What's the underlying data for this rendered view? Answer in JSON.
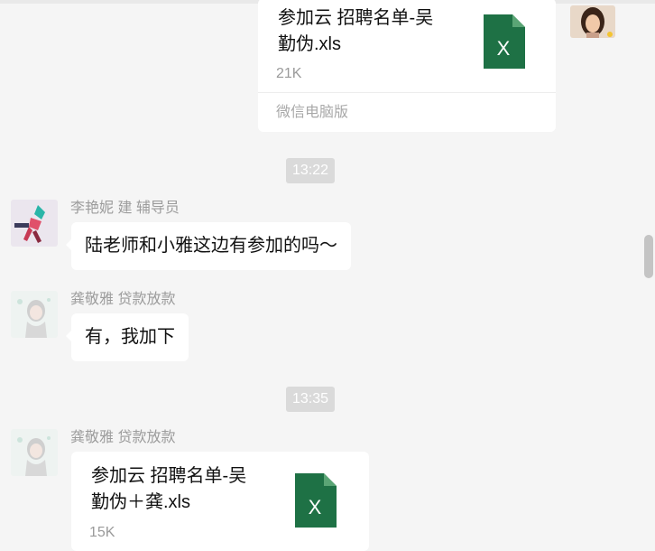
{
  "messages": {
    "file1": {
      "name_line1": "参加云 招聘名单-吴",
      "name_line2": "勤伪.xls",
      "size": "21K",
      "source": "微信电脑版",
      "icon": "excel-file-icon",
      "icon_letter": "X"
    },
    "time1": "13:22",
    "msg1": {
      "sender": "李艳妮 建 辅导员",
      "text": "陆老师和小雅这边有参加的吗～"
    },
    "msg2": {
      "sender": "龚敬雅 贷款放款",
      "text": "有，我加下"
    },
    "time2": "13:35",
    "file2": {
      "sender": "龚敬雅 贷款放款",
      "name_line1": "参加云 招聘名单-吴",
      "name_line2": "勤伪＋龚.xls",
      "size": "15K",
      "icon": "excel-file-icon",
      "icon_letter": "X"
    }
  },
  "colors": {
    "background": "#f5f5f5",
    "bubble": "#ffffff",
    "excel_green": "#1e7145",
    "time_chip": "#dadada"
  }
}
